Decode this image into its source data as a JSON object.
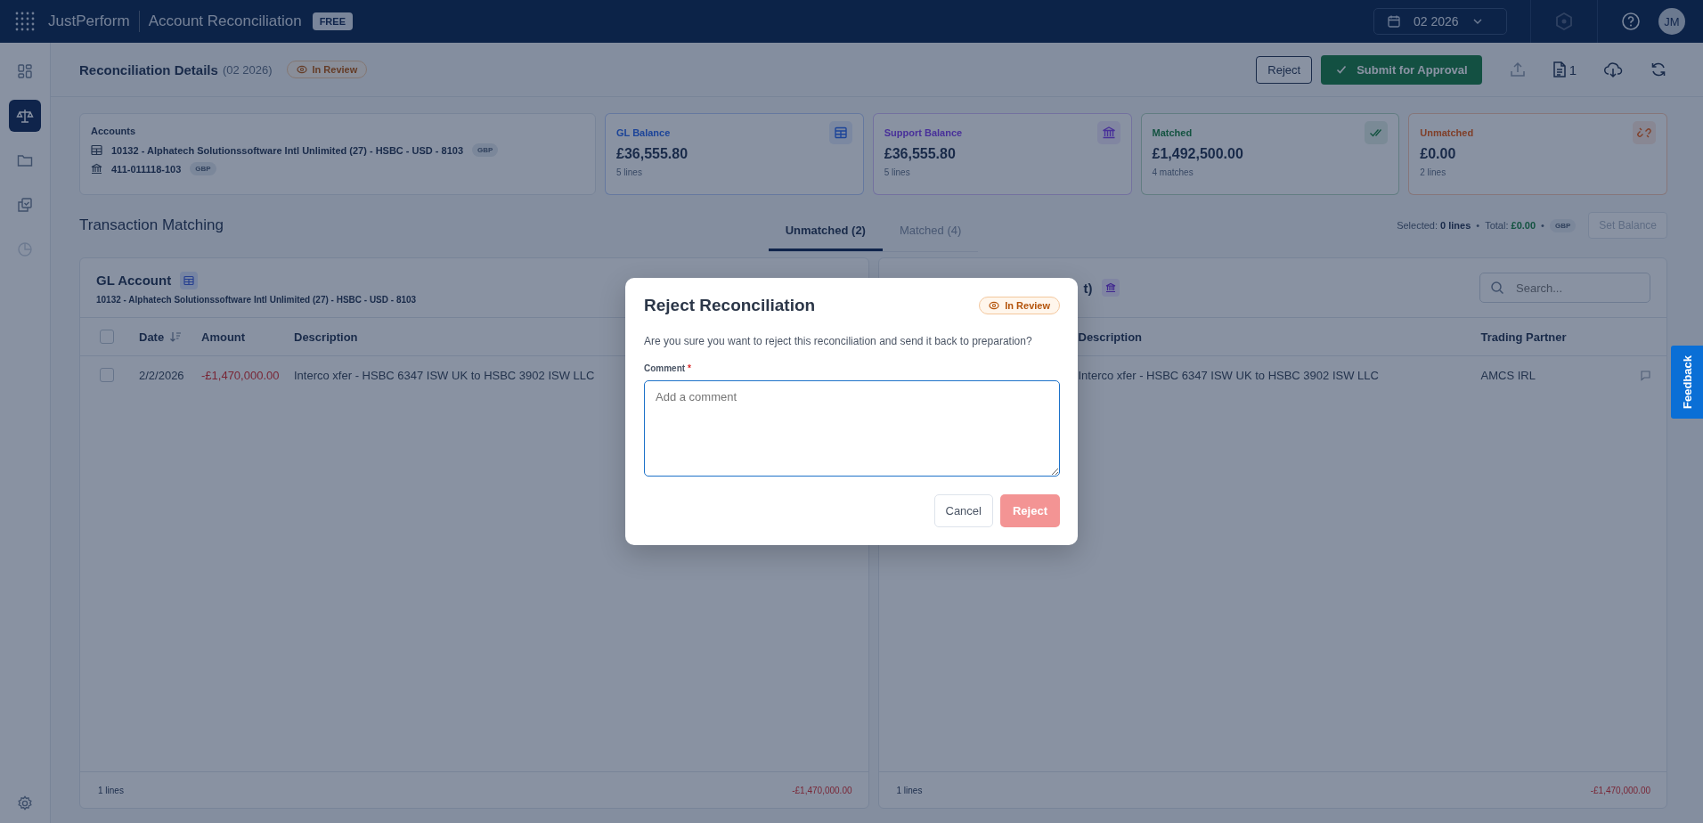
{
  "topbar": {
    "app": "JustPerform",
    "module": "Account Reconciliation",
    "plan_badge": "FREE",
    "period": "02 2026",
    "avatar": "JM"
  },
  "sidebar": {
    "items": [
      {
        "kind": "dashboard",
        "selected": false,
        "disabled": false
      },
      {
        "kind": "scales",
        "selected": true,
        "disabled": false
      },
      {
        "kind": "folder",
        "selected": false,
        "disabled": false
      },
      {
        "kind": "copy-check",
        "selected": false,
        "disabled": false
      },
      {
        "kind": "pie",
        "selected": false,
        "disabled": true
      }
    ]
  },
  "header": {
    "title": "Reconciliation Details",
    "period": "(02 2026)",
    "status": "In Review",
    "reject": "Reject",
    "submit": "Submit for Approval",
    "documents_count": "1"
  },
  "accounts_card": {
    "title": "Accounts",
    "accounts": [
      {
        "kind": "gl",
        "name": "10132 - Alphatech Solutionssoftware Intl Unlimited (27) - HSBC - USD - 8103",
        "currency": "GBP"
      },
      {
        "kind": "bank",
        "name": "411-011118-103",
        "currency": "GBP"
      }
    ]
  },
  "summary_cards": [
    {
      "kind": "gl",
      "label": "GL Balance",
      "value": "£36,555.80",
      "sub": "5 lines"
    },
    {
      "kind": "bank",
      "label": "Support Balance",
      "value": "£36,555.80",
      "sub": "5 lines"
    },
    {
      "kind": "matched",
      "label": "Matched",
      "value": "£1,492,500.00",
      "sub": "4 matches"
    },
    {
      "kind": "unmatched",
      "label": "Unmatched",
      "value": "£0.00",
      "sub": "2 lines"
    }
  ],
  "matching": {
    "title": "Transaction Matching",
    "tabs": [
      {
        "label": "Unmatched (2)",
        "selected": true
      },
      {
        "label": "Matched (4)",
        "selected": false
      }
    ],
    "selected_label": "Selected:",
    "selected_lines": "0 lines",
    "separator": "•",
    "total_label": "Total:",
    "total": "£0.00",
    "currency": "GBP",
    "set_balance": "Set Balance",
    "set_balance_disabled": true
  },
  "gl_panel": {
    "title": "GL Account",
    "subtitle": "10132 - Alphatech Solutionssoftware Intl Unlimited (27) - HSBC - USD - 8103",
    "columns": [
      "Date",
      "Amount",
      "Description"
    ],
    "all_selected": false,
    "sorted_by_date": true,
    "rows": [
      {
        "checked": false,
        "date": "2/2/2026",
        "amount": "-£1,470,000.00",
        "description": "Interco xfer - HSBC 6347 ISW UK to HSBC 3902 ISW LLC"
      }
    ],
    "footer_count": "1 lines",
    "footer_total": "-£1,470,000.00"
  },
  "support_panel": {
    "title": "t)",
    "search_placeholder": "Search...",
    "columns": [
      "Description",
      "Trading Partner"
    ],
    "rows": [
      {
        "description": "Interco xfer - HSBC 6347 ISW UK to HSBC 3902 ISW LLC",
        "trading_partner": "AMCS IRL"
      }
    ],
    "footer_count": "1 lines",
    "footer_total": "-£1,470,000.00"
  },
  "dialog": {
    "title": "Reject Reconciliation",
    "status": "In Review",
    "message": "Are you sure you want to reject this reconciliation and send it back to preparation?",
    "comment_label": "Comment",
    "required_mark": "*",
    "comment_placeholder": "Add a comment",
    "cancel": "Cancel",
    "reject": "Reject",
    "reject_disabled": true
  },
  "feedback": "Feedback"
}
